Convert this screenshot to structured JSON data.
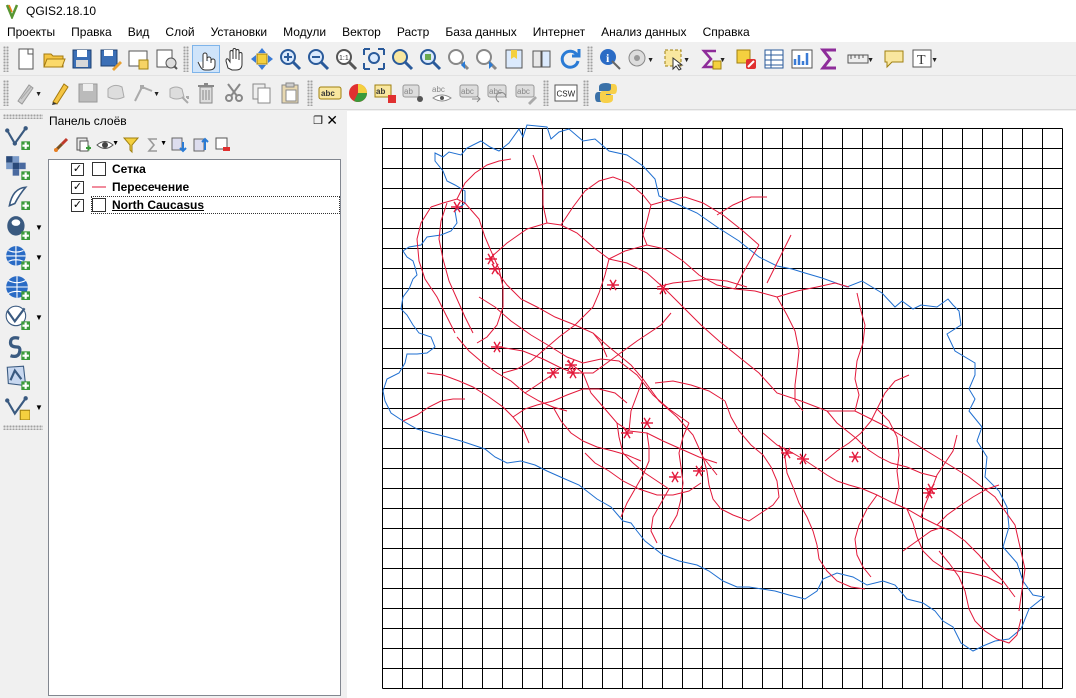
{
  "window": {
    "title": "QGIS2.18.10"
  },
  "menubar": {
    "items": [
      "Проекты",
      "Правка",
      "Вид",
      "Слой",
      "Установки",
      "Модули",
      "Вектор",
      "Растр",
      "База данных",
      "Интернет",
      "Анализ данных",
      "Справка"
    ]
  },
  "toolbar1": {
    "buttons": [
      "new-project",
      "open-project",
      "save-project",
      "save-as",
      "new-print-composer",
      "composer-manager",
      "touch-zoom",
      "pan",
      "pan-to-selection",
      "zoom-in",
      "zoom-out",
      "zoom-native",
      "zoom-full",
      "zoom-to-selection",
      "zoom-to-layer",
      "zoom-last",
      "zoom-next",
      "new-bookmark",
      "show-bookmarks",
      "refresh",
      "identify",
      "run-action",
      "select-features",
      "select-by-expression",
      "deselect",
      "open-attribute-table",
      "statistical-summary",
      "field-calculator",
      "measure",
      "map-tips",
      "text-annotation"
    ]
  },
  "toolbar2": {
    "buttons": [
      "current-edits",
      "toggle-editing",
      "save-edits",
      "add-feature",
      "node-tool",
      "move-feature",
      "delete-selected",
      "cut-features",
      "copy-features",
      "paste-features",
      "layer-labeling",
      "layer-diagram",
      "highlight-pinned-labels",
      "pin-labels",
      "show-hide-labels",
      "move-label",
      "rotate-label",
      "change-label",
      "csw",
      "python-console"
    ],
    "labels": {
      "abc": "abc",
      "csw": "CSW"
    }
  },
  "lefttoolbar": {
    "buttons": [
      "add-vector-layer",
      "add-raster-layer",
      "add-delimited-text-layer",
      "add-postgis-layer",
      "add-wms-layer",
      "add-wcs-layer",
      "add-wfs-layer",
      "add-spatialite-layer",
      "add-virtual-layer",
      "new-shapefile-layer"
    ]
  },
  "layers_panel": {
    "title": "Панель слоёв",
    "layers": [
      {
        "name": "Сетка",
        "checked": true,
        "symbol": "polygon",
        "selected": false
      },
      {
        "name": "Пересечение",
        "checked": true,
        "symbol": "line",
        "color": "#e3193b",
        "selected": false
      },
      {
        "name": "North Caucasus",
        "checked": true,
        "symbol": "polygon",
        "selected": true
      }
    ]
  },
  "map": {
    "grid_color": "#000000",
    "boundary_color": "#1f6fd1",
    "roads_color": "#e3193b"
  }
}
